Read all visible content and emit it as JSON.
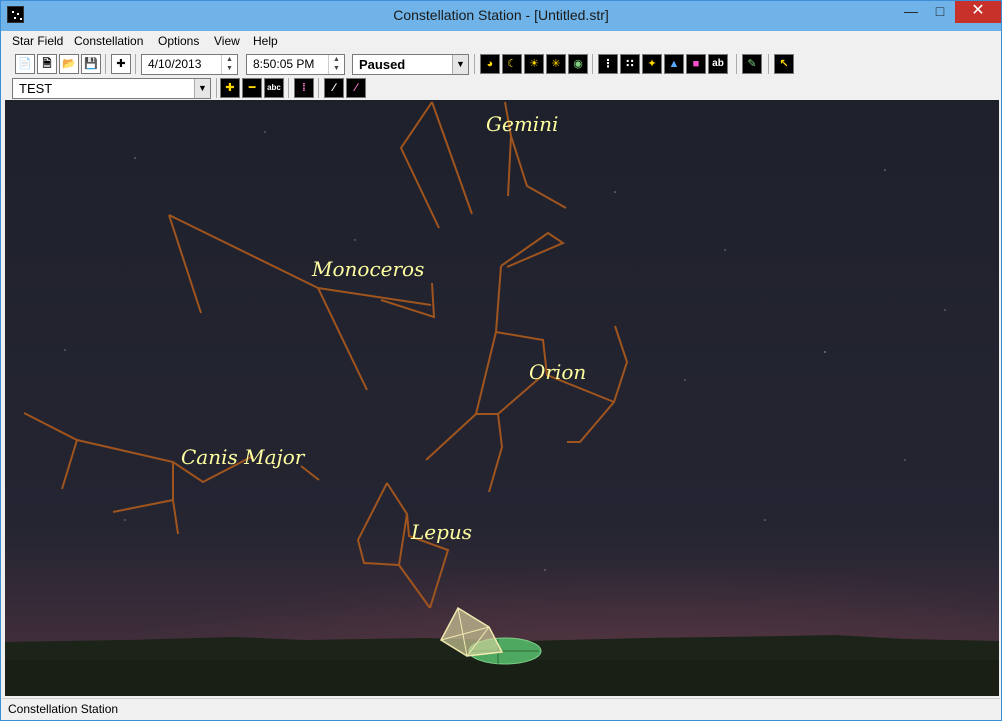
{
  "window": {
    "title": "Constellation Station - [Untitled.str]"
  },
  "menu": [
    "Star Field",
    "Constellation",
    "Options",
    "View",
    "Help"
  ],
  "toolbar": {
    "date": "4/10/2013",
    "time": "8:50:05 PM",
    "status_select": "Paused",
    "constellation_select": "TEST",
    "text_button_label": "abc",
    "text_button_label_2": "ab"
  },
  "sky": {
    "labels": {
      "gemini": "Gemini",
      "monoceros": "Monoceros",
      "orion": "Orion",
      "canis_major": "Canis Major",
      "lepus": "Lepus"
    },
    "colors": {
      "line": "#a0541e",
      "label": "#ffffa0",
      "sky_top": "#1f2230",
      "horizon_glow": "#5a3a44",
      "ground": "#1c2318"
    }
  },
  "statusbar": {
    "text": "Constellation Station"
  },
  "icons": [
    "app-icon",
    "new-file-icon",
    "open-file-icon",
    "folder-icon",
    "save-icon",
    "crosshair-icon",
    "zoom-in-icon",
    "zoom-out-icon",
    "text-label-icon"
  ]
}
